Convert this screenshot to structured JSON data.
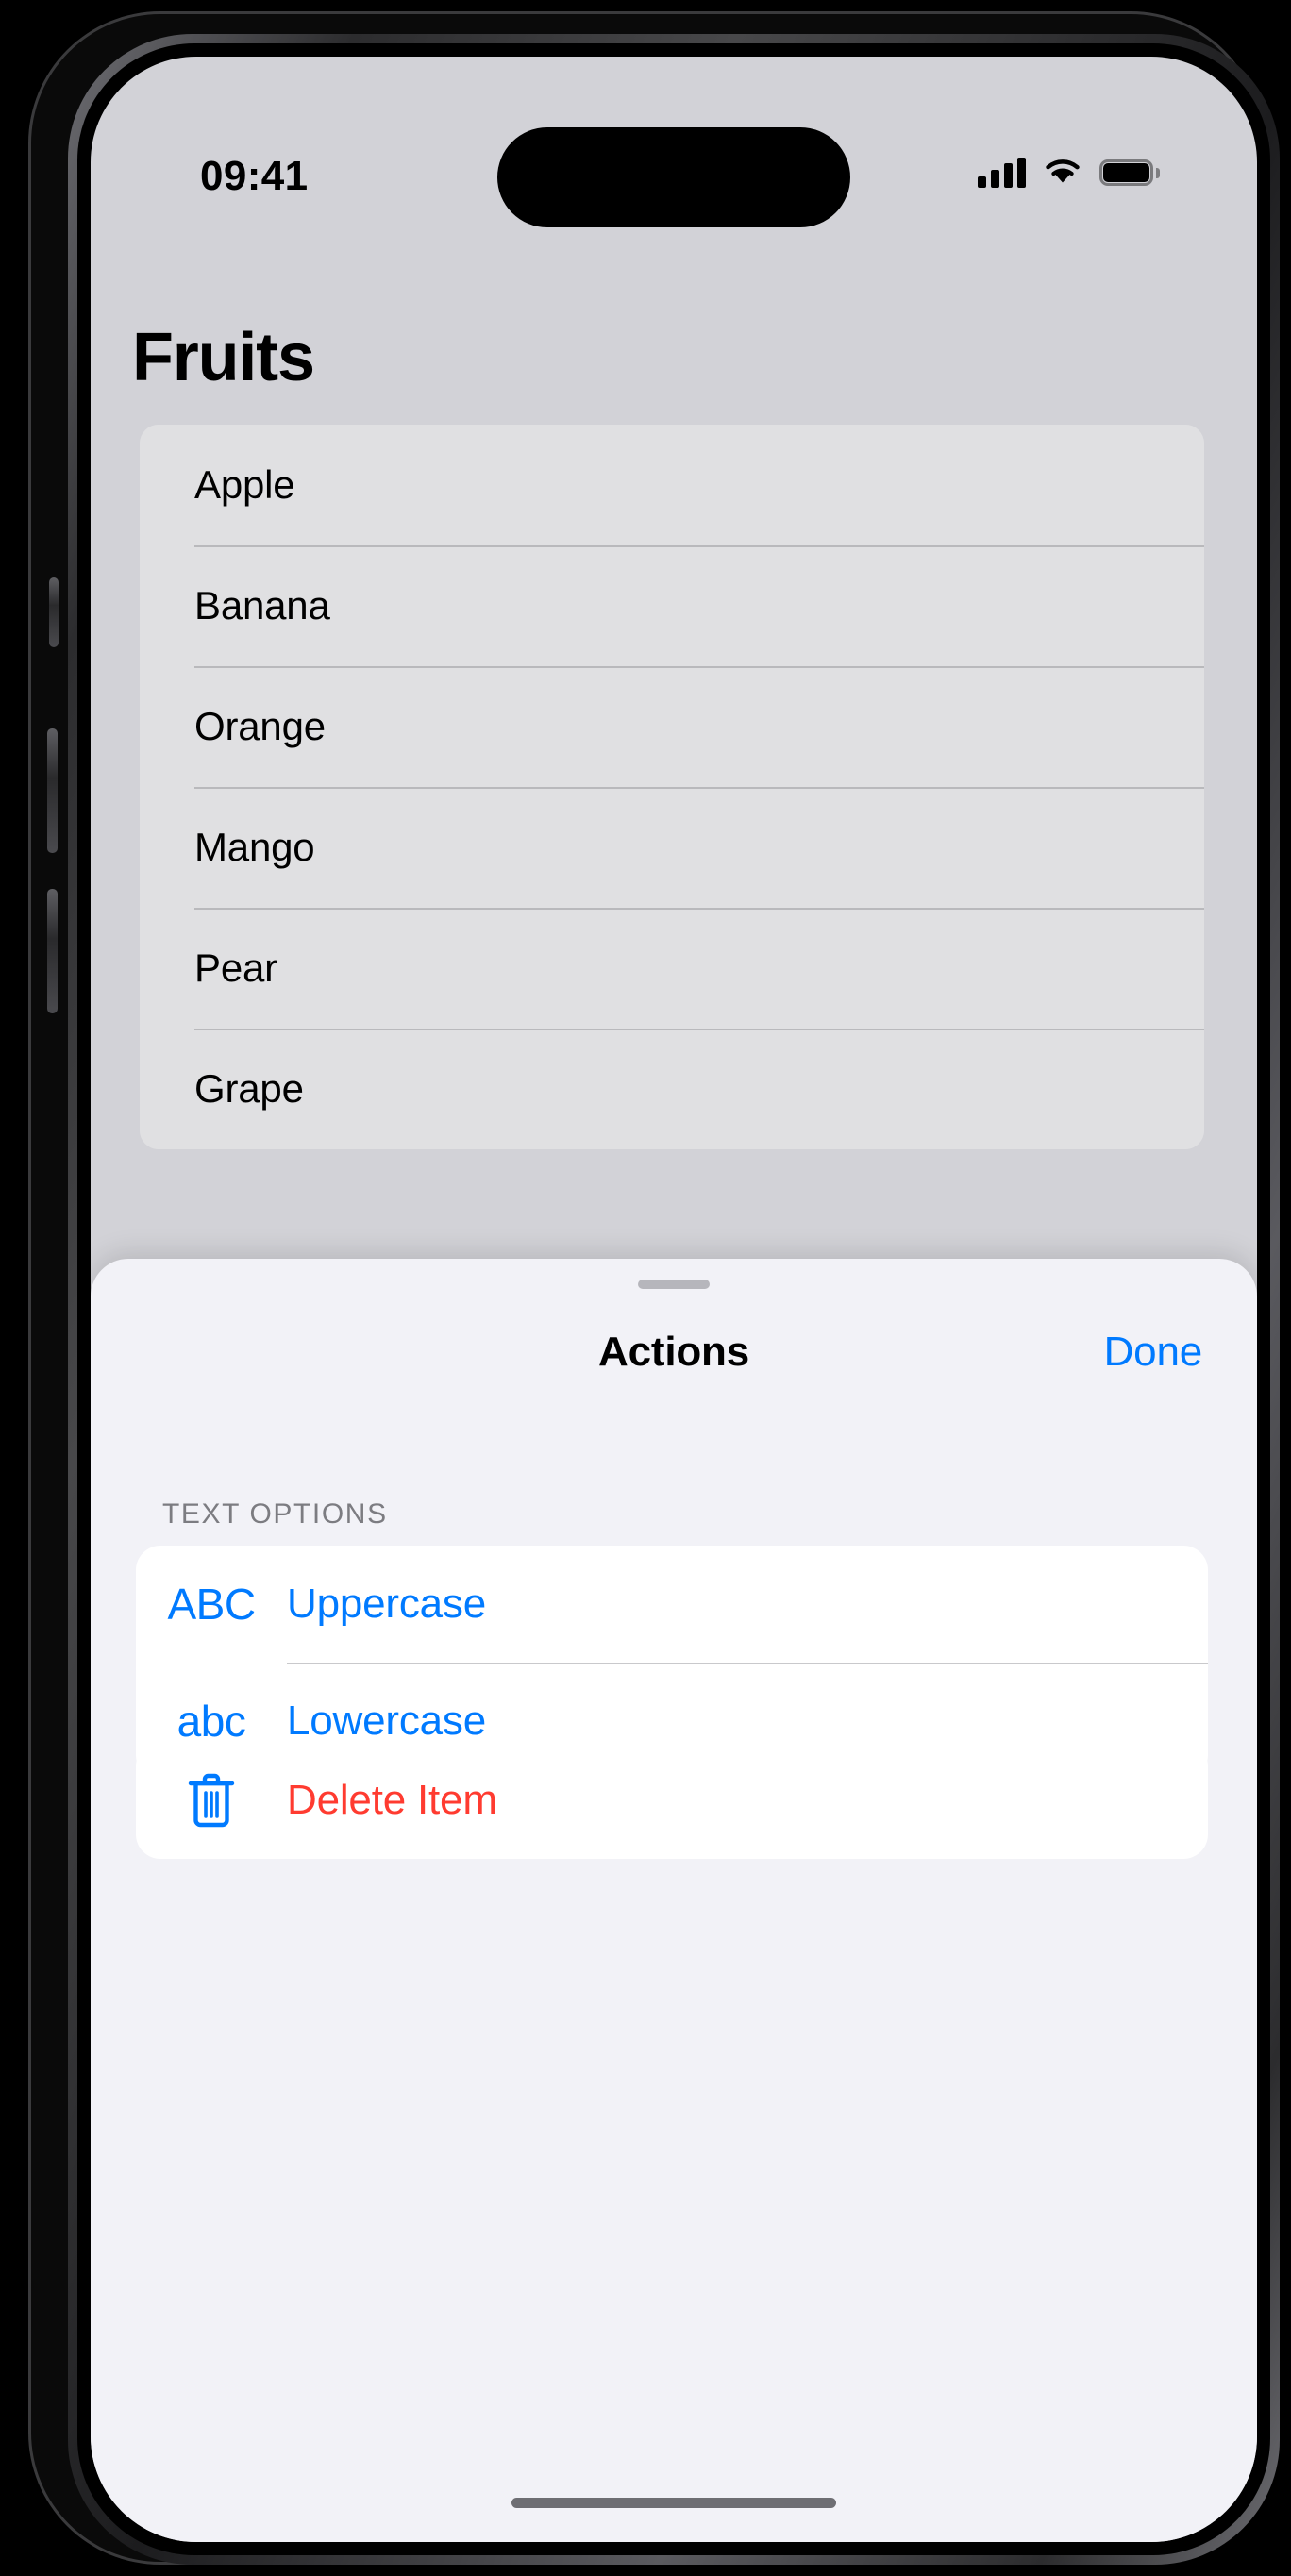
{
  "status_bar": {
    "time": "09:41",
    "cellular_icon": "cellular-bars-icon",
    "wifi_icon": "wifi-icon",
    "battery_icon": "battery-full-icon"
  },
  "main": {
    "title": "Fruits",
    "list_items": [
      {
        "label": "Apple"
      },
      {
        "label": "Banana"
      },
      {
        "label": "Orange"
      },
      {
        "label": "Mango"
      },
      {
        "label": "Pear"
      },
      {
        "label": "Grape"
      }
    ]
  },
  "action_sheet": {
    "title": "Actions",
    "done_label": "Done",
    "grabber": "sheet-grabber-handle",
    "sections": [
      {
        "header": "TEXT OPTIONS",
        "rows": [
          {
            "icon_glyph": "ABC",
            "icon_name": "uppercase-abc-icon",
            "label": "Uppercase",
            "tint": "#007AFF"
          },
          {
            "icon_glyph": "abc",
            "icon_name": "lowercase-abc-icon",
            "label": "Lowercase",
            "tint": "#007AFF"
          }
        ]
      },
      {
        "header": "",
        "rows": [
          {
            "icon_glyph": "",
            "icon_name": "trash-icon",
            "label": "Delete Item",
            "tint": "#FF3B30"
          }
        ]
      }
    ]
  },
  "colors": {
    "accent_blue": "#007AFF",
    "destructive_red": "#FF3B30",
    "sheet_background": "#F2F2F7",
    "list_background": "#E0E0E2",
    "screen_background": "#D2D2D7",
    "section_header_gray": "#7C7C81"
  }
}
